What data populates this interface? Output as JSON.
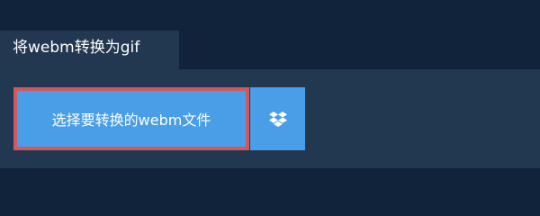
{
  "tab": {
    "label": "将webm转换为gif"
  },
  "upload": {
    "select_label": "选择要转换的webm文件",
    "dropbox_icon": "dropbox-icon"
  },
  "colors": {
    "background": "#11233a",
    "panel": "#213850",
    "button": "#4a9ee8",
    "highlight_border": "#d0595f"
  }
}
